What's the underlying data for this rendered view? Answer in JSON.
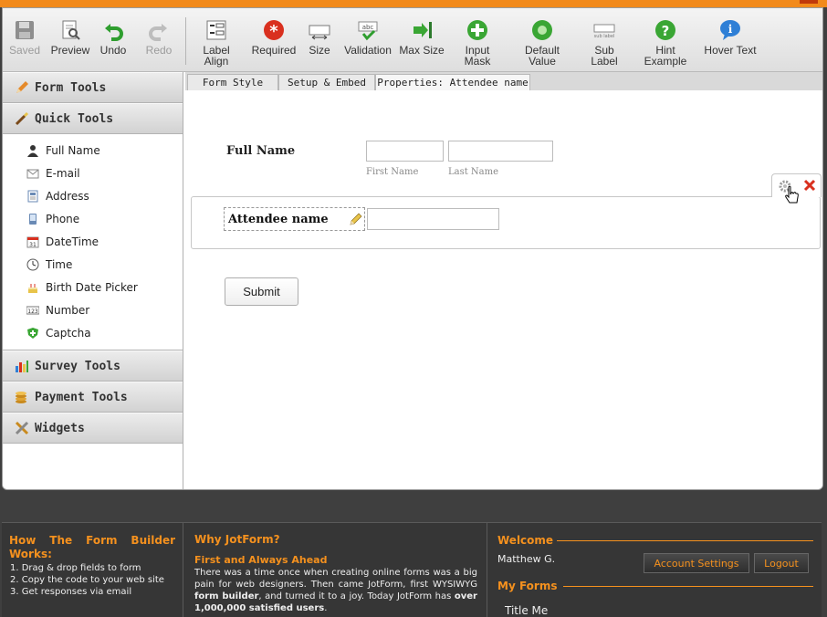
{
  "toolbar": {
    "items": [
      {
        "label": "Saved",
        "icon": "save-icon",
        "disabled": true
      },
      {
        "label": "Preview",
        "icon": "preview-icon",
        "disabled": false
      },
      {
        "label": "Undo",
        "icon": "undo-icon",
        "disabled": false
      },
      {
        "label": "Redo",
        "icon": "redo-icon",
        "disabled": true
      },
      {
        "label": "Label Align",
        "icon": "label-align-icon",
        "disabled": false
      },
      {
        "label": "Required",
        "icon": "required-icon",
        "disabled": false
      },
      {
        "label": "Size",
        "icon": "size-icon",
        "disabled": false
      },
      {
        "label": "Validation",
        "icon": "validation-icon",
        "disabled": false
      },
      {
        "label": "Max Size",
        "icon": "max-size-icon",
        "disabled": false
      },
      {
        "label": "Input Mask",
        "icon": "input-mask-icon",
        "disabled": false
      },
      {
        "label": "Default",
        "label2": "Value",
        "icon": "default-value-icon",
        "disabled": false
      },
      {
        "label": "Sub Label",
        "icon": "sub-label-icon",
        "disabled": false
      },
      {
        "label": "Hint",
        "label2": "Example",
        "icon": "hint-icon",
        "disabled": false
      },
      {
        "label": "Hover Text",
        "icon": "hover-text-icon",
        "disabled": false
      }
    ]
  },
  "sidebar": {
    "form_tools": "Form Tools",
    "quick_tools": "Quick Tools",
    "quick_items": [
      {
        "label": "Full Name",
        "icon": "person-icon"
      },
      {
        "label": "E-mail",
        "icon": "envelope-icon"
      },
      {
        "label": "Address",
        "icon": "address-icon"
      },
      {
        "label": "Phone",
        "icon": "phone-icon"
      },
      {
        "label": "DateTime",
        "icon": "calendar-icon"
      },
      {
        "label": "Time",
        "icon": "clock-icon"
      },
      {
        "label": "Birth Date Picker",
        "icon": "cake-icon"
      },
      {
        "label": "Number",
        "icon": "number-icon"
      },
      {
        "label": "Captcha",
        "icon": "shield-icon"
      }
    ],
    "survey_tools": "Survey Tools",
    "payment_tools": "Payment Tools",
    "widgets": "Widgets"
  },
  "tabs": [
    "Form Style",
    "Setup & Embed",
    "Properties: Attendee name"
  ],
  "form": {
    "full_name_label": "Full Name",
    "first_name_sub": "First Name",
    "last_name_sub": "Last Name",
    "attendee_label": "Attendee name",
    "submit_label": "Submit"
  },
  "footer": {
    "how_title": "How The Form Builder Works:",
    "how_steps": [
      "1.  Drag & drop fields to form",
      "2.  Copy the code to your web site",
      "3.  Get responses via email"
    ],
    "why_title": "Why JotForm?",
    "first_title": "First and Always Ahead",
    "first_text_1": "There was a time once when creating online forms was a big pain for web designers. Then came JotForm, first WYSIWYG ",
    "first_text_bold": "form builder",
    "first_text_2": ", and turned it to a joy. Today JotForm has ",
    "first_text_bold2": "over 1,000,000 satisfied users",
    "first_text_3": ".",
    "welcome_title": "Welcome",
    "user_name": "Matthew G.",
    "account_settings": "Account Settings",
    "logout": "Logout",
    "my_forms_title": "My Forms",
    "form_item": "Title Me"
  },
  "colors": {
    "accent": "#f28a1b",
    "footer_bg": "#363636",
    "required_red": "#d9301f",
    "check_green": "#3aa634"
  }
}
